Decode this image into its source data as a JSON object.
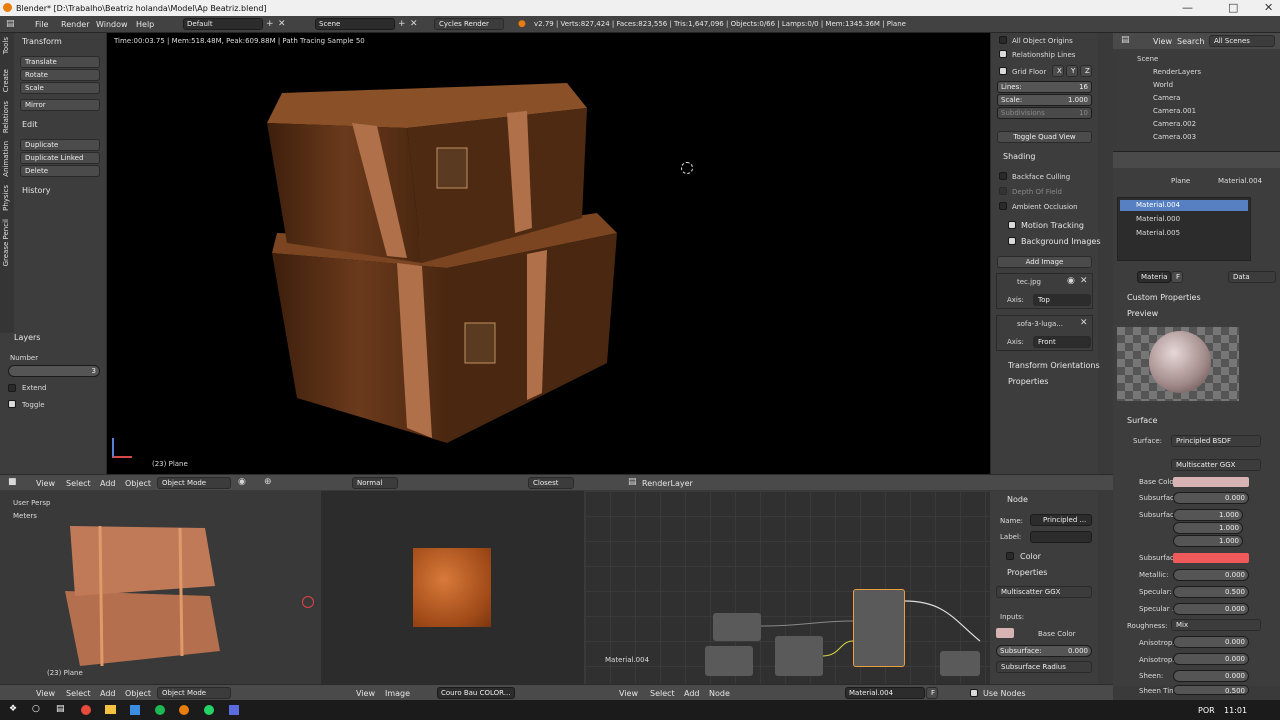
{
  "window": {
    "title": "Blender* [D:\\Trabalho\\Beatriz holanda\\Model\\Ap Beatriz.blend]"
  },
  "menu": {
    "file": "File",
    "render": "Render",
    "window": "Window",
    "help": "Help",
    "screen_layout": "Default",
    "scene": "Scene",
    "engine": "Cycles Render",
    "stats": "v2.79 | Verts:827,424 | Faces:823,556 | Tris:1,647,096 | Objects:0/66 | Lamps:0/0 | Mem:1345.36M | Plane"
  },
  "toolshelf": {
    "tabs": [
      "Tools",
      "Create",
      "Relations",
      "Animation",
      "Physics",
      "Grease Pencil"
    ],
    "transform_header": "Transform",
    "translate": "Translate",
    "rotate": "Rotate",
    "scale": "Scale",
    "mirror": "Mirror",
    "edit_header": "Edit",
    "duplicate": "Duplicate",
    "duplicate_linked": "Duplicate Linked",
    "delete": "Delete",
    "history_header": "History",
    "layers_header": "Layers",
    "number_label": "Number",
    "number_value": "3",
    "extend": "Extend",
    "toggle": "Toggle"
  },
  "viewport": {
    "render_status": "Time:00:03.75 | Mem:518.48M, Peak:609.88M | Path Tracing Sample 50",
    "object_label": "(23) Plane"
  },
  "npanel": {
    "all_object_origins": "All Object Origins",
    "relationship_lines": "Relationship Lines",
    "grid_floor": "Grid Floor",
    "x": "X",
    "y": "Y",
    "z": "Z",
    "lines_label": "Lines:",
    "lines_value": "16",
    "scale_label": "Scale:",
    "scale_value": "1.000",
    "subdivisions_label": "Subdivisions",
    "subdivisions_value": "10",
    "toggle_quad_view": "Toggle Quad View",
    "shading_header": "Shading",
    "backface_culling": "Backface Culling",
    "depth_of_field": "Depth Of Field",
    "ambient_occlusion": "Ambient Occlusion",
    "motion_tracking": "Motion Tracking",
    "background_images": "Background Images",
    "add_image": "Add Image",
    "image1": "tec.jpg",
    "image1_axis_label": "Axis:",
    "image1_axis": "Top",
    "image2": "sofa-3-luga...",
    "image2_axis_label": "Axis:",
    "image2_axis": "Front",
    "transform_orientations": "Transform Orientations",
    "properties": "Properties"
  },
  "viewport_header": {
    "view": "View",
    "select": "Select",
    "add": "Add",
    "object": "Object",
    "mode": "Object Mode",
    "pivot": "Normal",
    "snap": "Closest",
    "render_layer": "RenderLayer"
  },
  "outliner": {
    "view": "View",
    "search": "Search",
    "all_scenes": "All Scenes",
    "items": [
      "Scene",
      "RenderLayers",
      "World",
      "Camera",
      "Camera.001",
      "Camera.002",
      "Camera.003"
    ]
  },
  "properties": {
    "breadcrumb_object": "Plane",
    "breadcrumb_material": "Material.004",
    "materials": [
      "Material.004",
      "Material.000",
      "Material.005"
    ],
    "material_field": "Materia",
    "material_f": "F",
    "data_dropdown": "Data",
    "custom_properties": "Custom Properties",
    "preview": "Preview",
    "surface_header": "Surface",
    "surface_label": "Surface:",
    "surface_value": "Principled BSDF",
    "distribution": "Multiscatter GGX",
    "base_color": "Base Color:",
    "subsurface": "Subsurface:",
    "subsurface_value": "0.000",
    "subsurface_radius": "Subsurfac...",
    "radius1": "1.000",
    "radius2": "1.000",
    "radius3": "1.000",
    "subsurface_color": "Subsurfac...",
    "metallic": "Metallic:",
    "metallic_value": "0.000",
    "specular": "Specular:",
    "specular_value": "0.500",
    "specular_tint": "Specular ...",
    "specular_tint_value": "0.000",
    "roughness": "Roughness:",
    "roughness_value": "Mix",
    "anisotropic": "Anisotrop...",
    "anisotropic_value": "0.000",
    "anisotropic_rotation": "Anisotrop...",
    "anisotropic_rotation_value": "0.000",
    "sheen": "Sheen:",
    "sheen_value": "0.000",
    "sheen_tint": "Sheen Tint:",
    "sheen_tint_value": "0.500"
  },
  "bottom_left": {
    "view_label": "User Persp",
    "units": "Meters",
    "object_label": "(23) Plane",
    "view": "View",
    "select": "Select",
    "add": "Add",
    "object": "Object",
    "mode": "Object Mode"
  },
  "bottom_middle": {
    "view": "View",
    "image": "Image",
    "image_name": "Couro Bau COLOR..."
  },
  "node_editor": {
    "material_label": "Material.004",
    "view": "View",
    "select": "Select",
    "add": "Add",
    "node": "Node",
    "material_name": "Material.004",
    "f": "F",
    "use_nodes": "Use Nodes"
  },
  "node_panel": {
    "node_header": "Node",
    "name_label": "Name:",
    "name_value": "Principled ...",
    "label_label": "Label:",
    "color_header": "Color",
    "properties_header": "Properties",
    "distribution": "Multiscatter GGX",
    "inputs": "Inputs:",
    "base_color": "Base Color",
    "subsurface_label": "Subsurface:",
    "subsurface_value": "0.000",
    "subsurface_radius": "Subsurface Radius"
  },
  "taskbar": {
    "language": "POR",
    "time": "11:01"
  },
  "colors": {
    "accent_blue": "#5680c2",
    "subsurface_color": "#f05a5a",
    "base_color": "#d7b3b3",
    "wood": "#6b3a1c"
  }
}
